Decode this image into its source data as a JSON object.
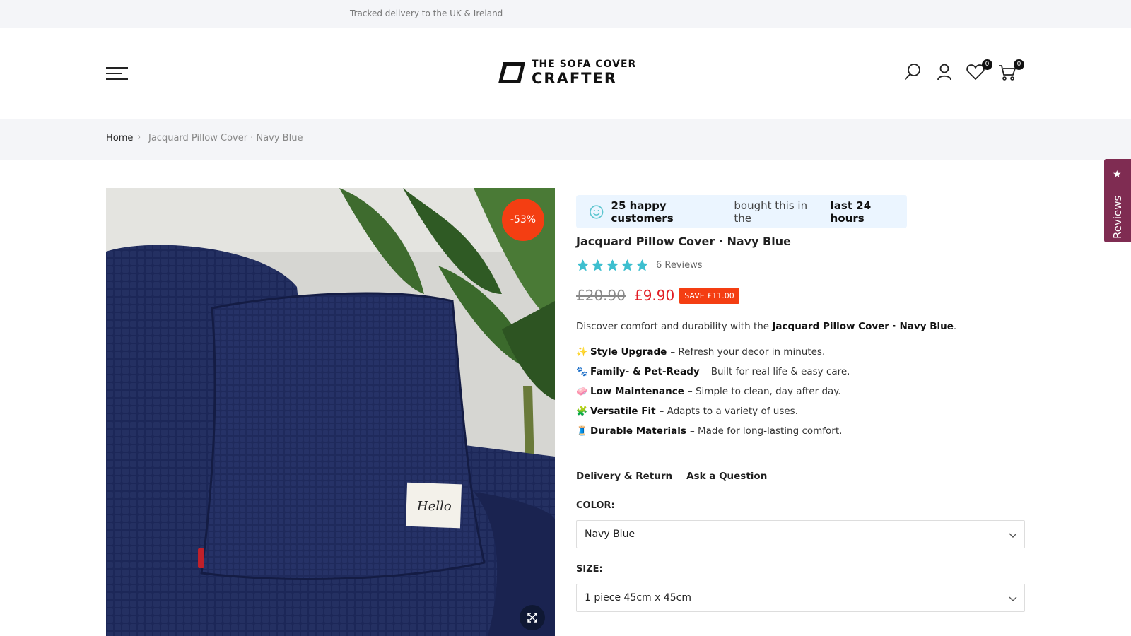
{
  "announcement": {
    "text": "Tracked delivery to the UK & Ireland"
  },
  "header": {
    "logo_line1": "THE SOFA COVER",
    "logo_line2": "CRAFTER",
    "wishlist_count": "0",
    "cart_count": "0",
    "icons": [
      "menu-icon",
      "search-icon",
      "account-icon",
      "heart-icon",
      "cart-icon"
    ]
  },
  "breadcrumb": {
    "home": "Home",
    "separator": "›",
    "current": "Jacquard Pillow Cover · Navy Blue"
  },
  "media": {
    "discount_badge": "-53%"
  },
  "product": {
    "happy_count": "25 happy customers",
    "happy_mid": "bought this in the",
    "happy_period": "last 24 hours",
    "title": "Jacquard Pillow Cover · Navy Blue",
    "rating_stars": 5,
    "reviews_text": "6 Reviews",
    "price_old": "£20.90",
    "price_new": "£9.90",
    "save_badge": "SAVE £11.00",
    "desc_prefix": "Discover comfort and durability with the",
    "desc_name": "Jacquard Pillow Cover · Navy Blue",
    "desc_suffix": ".",
    "features": [
      {
        "emoji": "✨",
        "title": "Style Upgrade",
        "text": "– Refresh your decor in minutes."
      },
      {
        "emoji": "🐾",
        "title": "Family- & Pet-Ready",
        "text": "– Built for real life & easy care."
      },
      {
        "emoji": "🧼",
        "title": "Low Maintenance",
        "text": "– Simple to clean, day after day."
      },
      {
        "emoji": "🧩",
        "title": "Versatile Fit",
        "text": "– Adapts to a variety of uses."
      },
      {
        "emoji": "🧵",
        "title": "Durable Materials",
        "text": "– Made for long-lasting comfort."
      }
    ],
    "link_delivery": "Delivery & Return",
    "link_question": "Ask a Question",
    "color_label": "COLOR:",
    "color_value": "Navy Blue",
    "size_label": "SIZE:",
    "size_value": "1 piece 45cm x 45cm"
  },
  "reviews_tab": {
    "label": "Reviews"
  },
  "colors": {
    "accent_sale": "#f43e12",
    "price_red": "#e11b22",
    "star_teal": "#3dbfcf",
    "reviews_tab": "#7f2c52"
  }
}
